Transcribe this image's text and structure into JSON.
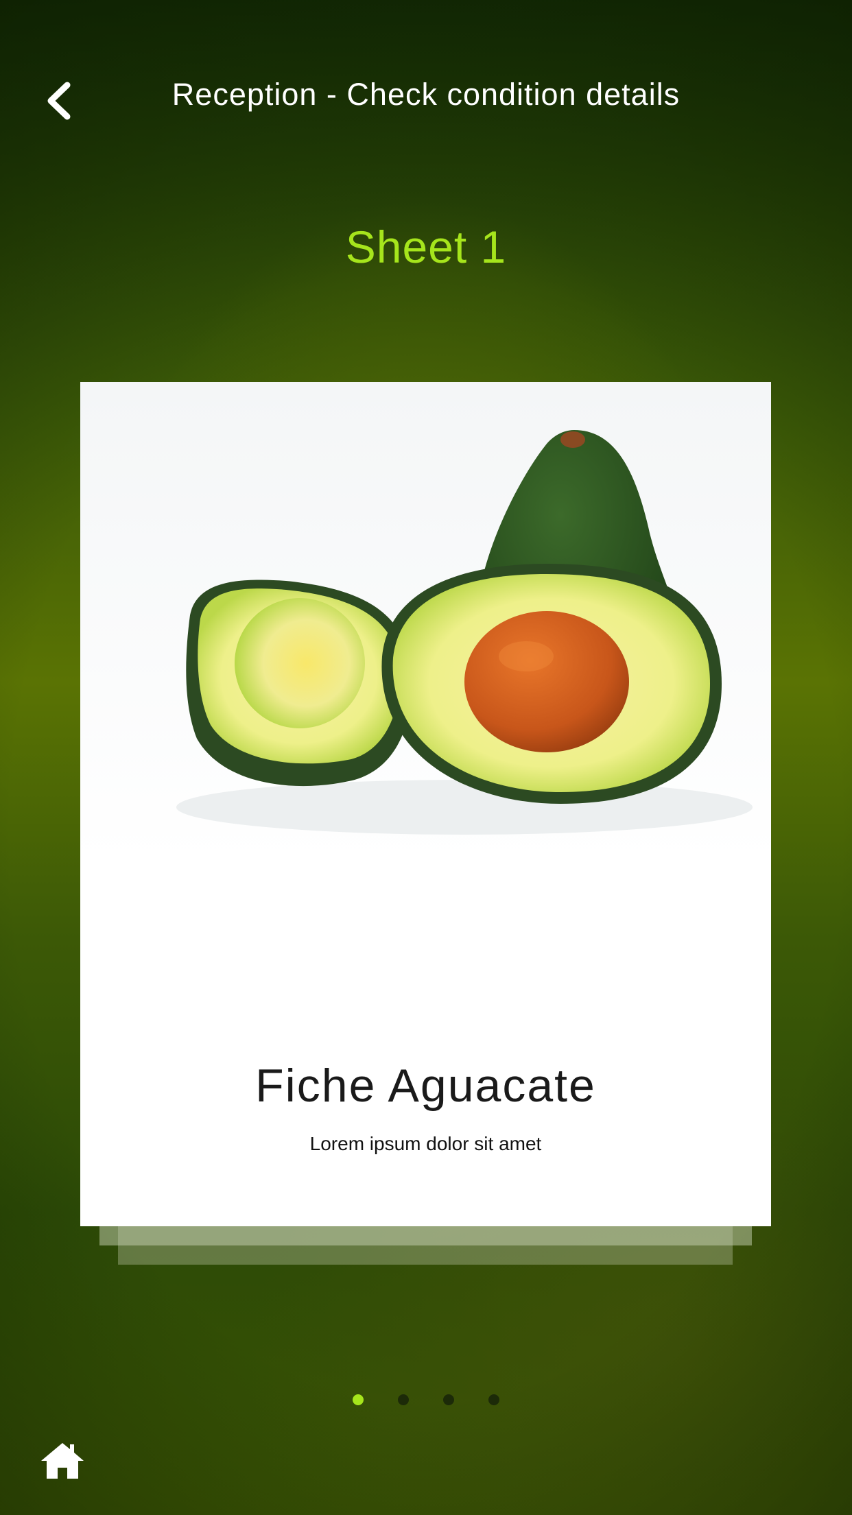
{
  "header": {
    "back_icon": "chevron-left-icon",
    "title": "Reception - Check condition details"
  },
  "sheet": {
    "title": "Sheet 1"
  },
  "card": {
    "image": "avocado-photo",
    "title": "Fiche Aguacate",
    "subtitle": "Lorem ipsum dolor sit amet"
  },
  "pagination": {
    "total": 4,
    "active_index": 0
  },
  "footer": {
    "home_icon": "home-icon"
  },
  "colors": {
    "accent": "#a6e51c",
    "background_dark": "#142c05",
    "background_mid": "#5a7304"
  }
}
